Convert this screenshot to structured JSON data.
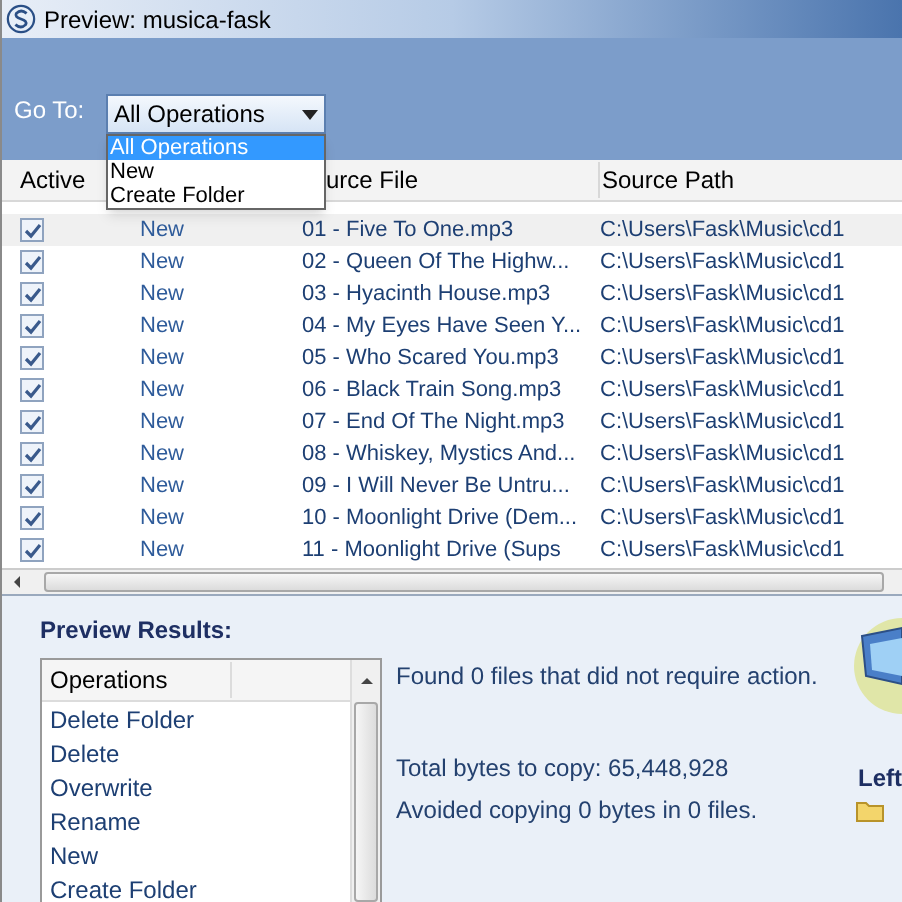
{
  "window": {
    "title": "Preview: musica-fask"
  },
  "go_to": {
    "label": "Go To:",
    "value": "All Operations",
    "expanded": true,
    "options": [
      {
        "label": "All Operations",
        "selected": true
      },
      {
        "label": "New",
        "selected": false
      },
      {
        "label": "Create Folder",
        "selected": false
      }
    ]
  },
  "table": {
    "header": {
      "active": "Active",
      "source_file": "urce File",
      "source_path": "Source Path"
    },
    "rows": [
      {
        "active": true,
        "action": "New",
        "source_file": "01 - Five To One.mp3",
        "source_path": "C:\\Users\\Fask\\Music\\cd1"
      },
      {
        "active": true,
        "action": "New",
        "source_file": "02 - Queen Of The Highw...",
        "source_path": "C:\\Users\\Fask\\Music\\cd1"
      },
      {
        "active": true,
        "action": "New",
        "source_file": "03 - Hyacinth House.mp3",
        "source_path": "C:\\Users\\Fask\\Music\\cd1"
      },
      {
        "active": true,
        "action": "New",
        "source_file": "04 - My Eyes Have Seen Y...",
        "source_path": "C:\\Users\\Fask\\Music\\cd1"
      },
      {
        "active": true,
        "action": "New",
        "source_file": "05 - Who Scared You.mp3",
        "source_path": "C:\\Users\\Fask\\Music\\cd1"
      },
      {
        "active": true,
        "action": "New",
        "source_file": "06 - Black Train Song.mp3",
        "source_path": "C:\\Users\\Fask\\Music\\cd1"
      },
      {
        "active": true,
        "action": "New",
        "source_file": "07 - End Of The Night.mp3",
        "source_path": "C:\\Users\\Fask\\Music\\cd1"
      },
      {
        "active": true,
        "action": "New",
        "source_file": "08 - Whiskey, Mystics And...",
        "source_path": "C:\\Users\\Fask\\Music\\cd1"
      },
      {
        "active": true,
        "action": "New",
        "source_file": "09 - I Will Never Be Untru...",
        "source_path": "C:\\Users\\Fask\\Music\\cd1"
      },
      {
        "active": true,
        "action": "New",
        "source_file": "10 - Moonlight Drive (Dem...",
        "source_path": "C:\\Users\\Fask\\Music\\cd1"
      },
      {
        "active": true,
        "action": "New",
        "source_file": "11 - Moonlight Drive (Sups",
        "source_path": "C:\\Users\\Fask\\Music\\cd1"
      }
    ]
  },
  "preview_results": {
    "title": "Preview Results:",
    "operations_header": "Operations",
    "operations": [
      "Delete Folder",
      "Delete",
      "Overwrite",
      "Rename",
      "New",
      "Create Folder"
    ],
    "messages": [
      "Found 0 files that did not require action.",
      "Total bytes to copy: 65,448,928",
      "Avoided copying 0 bytes in 0 files."
    ],
    "side_label": "Left"
  }
}
